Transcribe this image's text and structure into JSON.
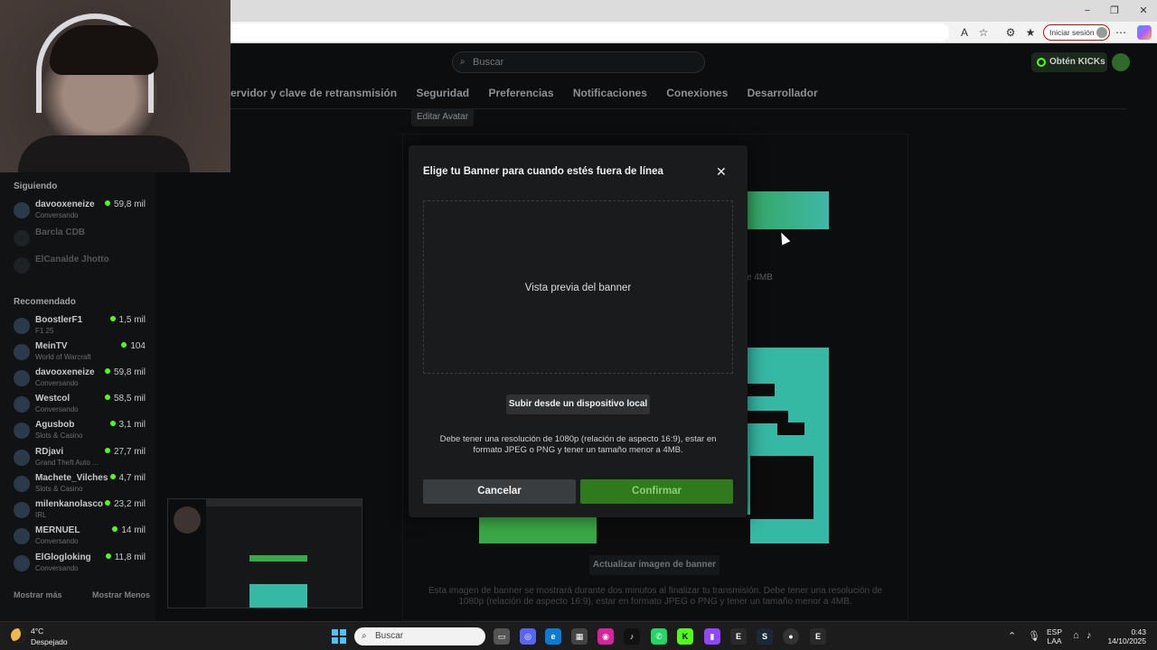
{
  "browser": {
    "signin_label": "Iniciar sesión",
    "minimize": "−",
    "maximize": "❐",
    "close": "✕"
  },
  "header": {
    "search_placeholder": "Buscar",
    "kicks_label": "Obtén KICKs"
  },
  "settings_tabs": [
    "ervidor y clave de retransmisión",
    "Seguridad",
    "Preferencias",
    "Notificaciones",
    "Conexiones",
    "Desarrollador"
  ],
  "edit_avatar_label": "Editar Avatar",
  "bg_hint": "e 4MB",
  "update_banner_label": "Actualizar imagen de banner",
  "bg_note": "Esta imagen de banner se mostrará durante dos minutos al finalizar tu transmisión. Debe tener una resolución de 1080p (relación de aspecto 16:9), estar en formato JPEG o PNG y tener un tamaño menor a 4MB.",
  "sidebar": {
    "following_title": "Siguiendo",
    "following": [
      {
        "name": "davooxeneize",
        "sub": "Conversando",
        "viewers": "59,8 mil",
        "online": true
      },
      {
        "name": "Barcla CDB",
        "sub": "",
        "viewers": "",
        "online": false
      },
      {
        "name": "ElCanalde Jhotto",
        "sub": "",
        "viewers": "",
        "online": false
      }
    ],
    "recommended_title": "Recomendado",
    "recommended": [
      {
        "name": "BoostlerF1",
        "sub": "F1 25",
        "viewers": "1,5 mil"
      },
      {
        "name": "MeinTV",
        "sub": "World of Warcraft",
        "viewers": "104"
      },
      {
        "name": "davooxeneize",
        "sub": "Conversando",
        "viewers": "59,8 mil"
      },
      {
        "name": "Westcol",
        "sub": "Conversando",
        "viewers": "58,5 mil"
      },
      {
        "name": "Agusbob",
        "sub": "Slots & Casino",
        "viewers": "3,1 mil"
      },
      {
        "name": "RDjavi",
        "sub": "Grand Theft Auto ...",
        "viewers": "27,7 mil"
      },
      {
        "name": "Machete_Vilches",
        "sub": "Slots & Casino",
        "viewers": "4,7 mil"
      },
      {
        "name": "milenkanolasco",
        "sub": "IRL",
        "viewers": "23,2 mil"
      },
      {
        "name": "MERNUEL",
        "sub": "Conversando",
        "viewers": "14 mil"
      },
      {
        "name": "ElGlogloking",
        "sub": "Conversando",
        "viewers": "11,8 mil"
      }
    ],
    "show_more": "Mostrar más",
    "show_less": "Mostrar Menos"
  },
  "modal": {
    "title": "Elige tu Banner para cuando estés fuera de línea",
    "close_icon": "✕",
    "preview_label": "Vista previa del banner",
    "upload_label": "Subir desde un dispositivo local",
    "note": "Debe tener una resolución de 1080p (relación de aspecto 16:9), estar en formato JPEG o PNG y tener un tamaño menor a 4MB.",
    "cancel_label": "Cancelar",
    "confirm_label": "Confirmar"
  },
  "taskbar": {
    "temp": "4°C",
    "weather": "Despejado",
    "search_placeholder": "Buscar",
    "lang_top": "ESP",
    "lang_bottom": "LAA",
    "time": "0:43",
    "date": "14/10/2025"
  },
  "colors": {
    "kick_green": "#53fc18",
    "confirm_green": "#2f7a1d",
    "modal_bg": "#191b1c",
    "page_bg": "#0b0d0e"
  }
}
